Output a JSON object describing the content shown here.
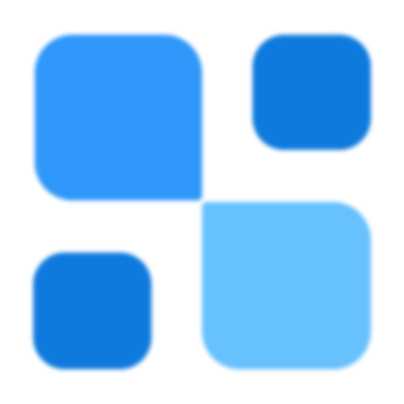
{
  "icon": {
    "semantic": "blocks-grid-icon",
    "tiles": {
      "top_left": {
        "color": "#2f97f9"
      },
      "top_right": {
        "color": "#0f7ade"
      },
      "bottom_left": {
        "color": "#0f7ade"
      },
      "bottom_right": {
        "color": "#66c1fd"
      }
    }
  }
}
